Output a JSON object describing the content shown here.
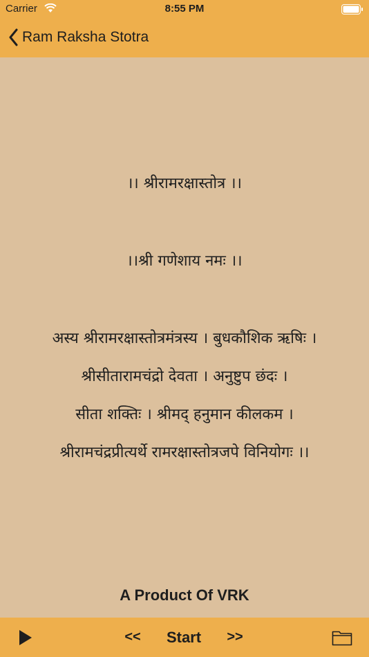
{
  "status_bar": {
    "carrier": "Carrier",
    "time": "8:55 PM"
  },
  "nav": {
    "back_icon": "chevron-left-icon",
    "title": "Ram Raksha Stotra"
  },
  "content": {
    "lines": [
      "।। श्रीरामरक्षास्तोत्र ।।",
      "।।श्री गणेशाय नमः ।।",
      "अस्य श्रीरामरक्षास्तोत्रमंत्रस्य । बुधकौशिक ऋषिः ।",
      "श्रीसीतारामचंद्रो देवता । अनुष्टुप छंदः ।",
      "सीता शक्तिः । श्रीमद् हनुमान कीलकम ।",
      "श्रीरामचंद्रप्रीत्यर्थे रामरक्षास्तोत्रजपे विनियोगः ।।"
    ],
    "credit": "A Product Of VRK"
  },
  "toolbar": {
    "play_icon": "play-icon",
    "prev_label": "<<",
    "start_label": "Start",
    "next_label": ">>",
    "folder_icon": "folder-icon"
  },
  "colors": {
    "bar": "#eeaf4c",
    "background": "#dcc09d",
    "text": "#1e1e1e"
  }
}
